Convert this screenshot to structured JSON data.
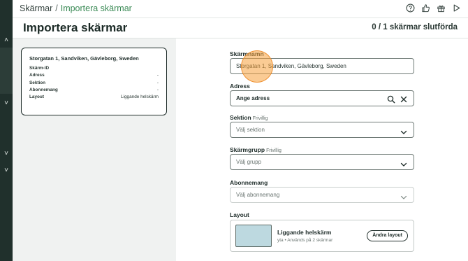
{
  "breadcrumb": {
    "root": "Skärmar",
    "separator": "/",
    "current": "Importera skärmar"
  },
  "top_icons": [
    "help-icon",
    "thumbs-up-icon",
    "gift-icon",
    "play-icon"
  ],
  "header": {
    "title": "Importera skärmar",
    "progress": "0 / 1 skärmar slutförda"
  },
  "card": {
    "title": "Storgatan 1, Sandviken, Gävleborg, Sweden",
    "rows": [
      {
        "key": "Skärm-ID",
        "value": ""
      },
      {
        "key": "Adress",
        "value": "-"
      },
      {
        "key": "Sektion",
        "value": "-"
      },
      {
        "key": "Abonnemang",
        "value": "-"
      },
      {
        "key": "Layout",
        "value": "Liggande helskärm"
      }
    ]
  },
  "form": {
    "name": {
      "label": "Skärmnamn",
      "value": "Storgatan 1, Sandviken, Gävleborg, Sweden"
    },
    "address": {
      "label": "Adress",
      "value": "Ange adress"
    },
    "section": {
      "label": "Sektion",
      "optional": "Frivillig",
      "placeholder": "Välj sektion"
    },
    "group": {
      "label": "Skärmgrupp",
      "optional": "Frivillig",
      "placeholder": "Välj grupp"
    },
    "subscription": {
      "label": "Abonnemang",
      "placeholder": "Välj abonnemang"
    },
    "layout": {
      "label": "Layout",
      "name": "Liggande helskärm",
      "sub": "yta • Används på 2 skärmar",
      "button": "Ändra layout"
    }
  },
  "colors": {
    "accent": "#3a8a55",
    "rail": "#20302c",
    "left_pane": "#f0f2f1",
    "cursor": "#f5a03c"
  }
}
